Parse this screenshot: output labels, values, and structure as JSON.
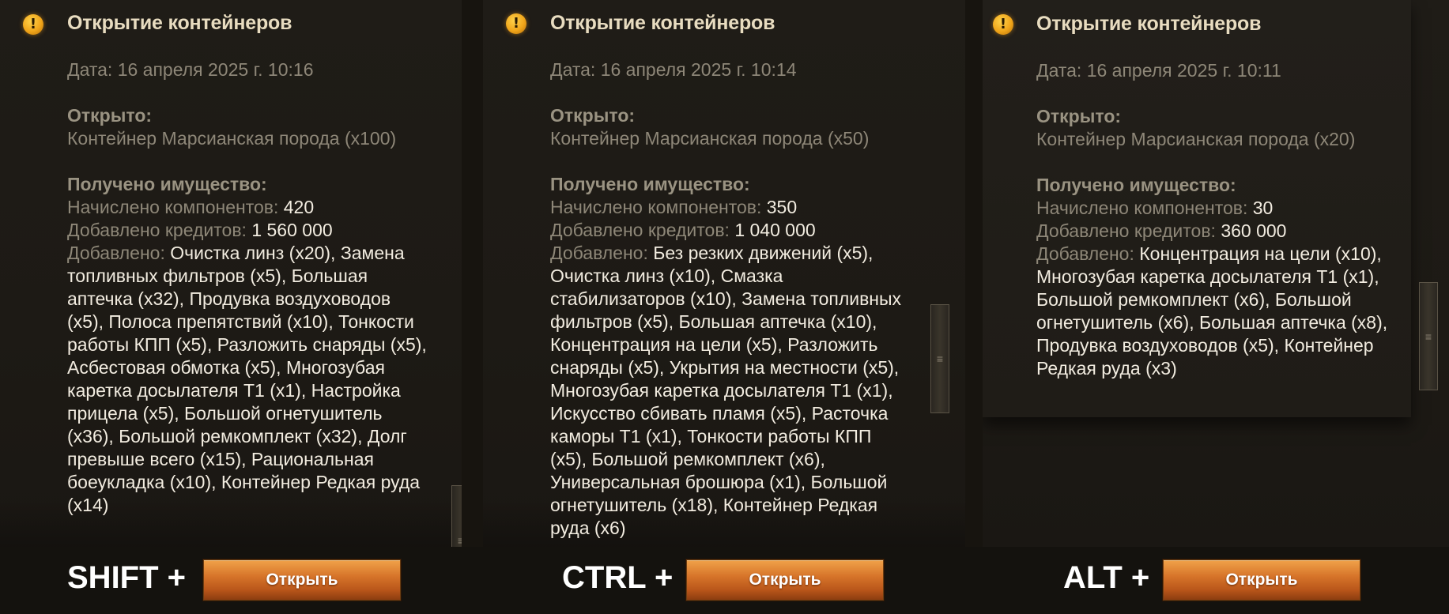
{
  "panels": [
    {
      "title": "Открытие контейнеров",
      "date": "Дата: 16 апреля 2025 г. 10:16",
      "opened_label": "Открыто:",
      "opened_value": "Контейнер Марсианская порода (x100)",
      "received_label": "Получено имущество:",
      "components_label": "Начислено компонентов:",
      "components_value": "420",
      "credits_label": "Добавлено кредитов:",
      "credits_value": "1 560 000",
      "added_label": "Добавлено:",
      "added_value": "Очистка линз (x20), Замена топливных фильтров (x5), Большая аптечка (x32), Продувка воздуховодов (x5), Полоса препятствий (x10), Тонкости работы КПП (x5), Разложить снаряды (x5), Асбестовая обмотка (x5), Многозубая каретка досылателя Т1 (x1), Настройка прицела (x5), Большой огнетушитель (x36), Большой ремкомплект (x32), Долг превыше всего (x15), Рациональная боеукладка (x10), Контейнер Редкая руда (x14)"
    },
    {
      "title": "Открытие контейнеров",
      "date": "Дата: 16 апреля 2025 г. 10:14",
      "opened_label": "Открыто:",
      "opened_value": "Контейнер Марсианская порода (x50)",
      "received_label": "Получено имущество:",
      "components_label": "Начислено компонентов:",
      "components_value": "350",
      "credits_label": "Добавлено кредитов:",
      "credits_value": "1 040 000",
      "added_label": "Добавлено:",
      "added_value": "Без резких движений (x5), Очистка линз (x10), Смазка стабилизаторов (x10), Замена топливных фильтров (x5), Большая аптечка (x10), Концентрация на цели (x5), Разложить снаряды (x5), Укрытия на местности (x5), Многозубая каретка досылателя Т1 (x1), Искусство сбивать пламя (x5), Расточка каморы Т1 (x1), Тонкости работы КПП (x5), Большой ремкомплект (x6), Универсальная брошюра (x1), Большой огнетушитель (x18), Контейнер Редкая руда (x6)"
    },
    {
      "title": "Открытие контейнеров",
      "date": "Дата: 16 апреля 2025 г. 10:11",
      "opened_label": "Открыто:",
      "opened_value": "Контейнер Марсианская порода (x20)",
      "received_label": "Получено имущество:",
      "components_label": "Начислено компонентов:",
      "components_value": "30",
      "credits_label": "Добавлено кредитов:",
      "credits_value": "360 000",
      "added_label": "Добавлено:",
      "added_value": "Концентрация на цели (x10), Многозубая каретка досылателя Т1 (x1), Большой ремкомплект (x6), Большой огнетушитель (x6), Большая аптечка (x8), Продувка воздуховодов (x5), Контейнер Редкая руда (x3)"
    }
  ],
  "footer": {
    "hotkeys": [
      "SHIFT +",
      "CTRL +",
      "ALT +"
    ],
    "button_label": "Открыть"
  },
  "icons": {
    "warning": "warning-icon",
    "scroll_grip": "grip-icon"
  },
  "colors": {
    "title": "#e8dcc0",
    "muted_text": "#8e8778",
    "value_text": "#f2ece0",
    "button_orange": "#d7752a"
  }
}
